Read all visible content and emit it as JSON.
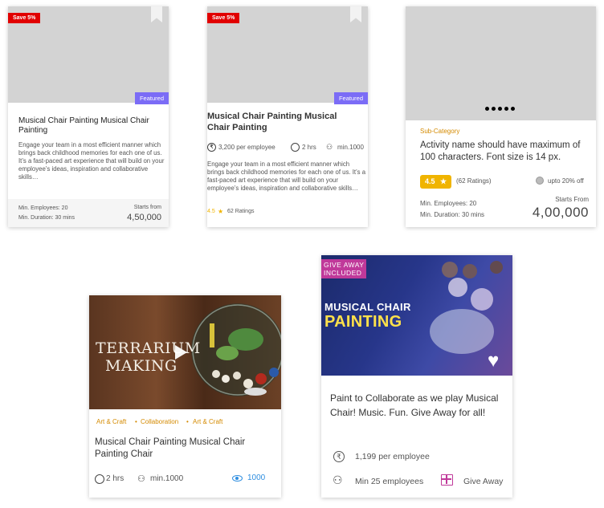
{
  "card1": {
    "save_badge": "Save 5%",
    "featured": "Featured",
    "title": "Musical Chair Painting Musical Chair Painting",
    "desc": "Engage your team in a most efficient manner which brings back childhood memories for each one of us. It’s a fast-paced art experience that will build on your employee’s ideas, inspiration and collaborative skills…",
    "min_employees": "Min. Employees: 20",
    "min_duration": "Min. Duration: 30 mins",
    "starts_from": "Starts from",
    "price": "4,50,000"
  },
  "card2": {
    "save_badge": "Save 5%",
    "featured": "Featured",
    "title": "Musical Chair Painting Musical Chair Painting",
    "per_employee": "3,200 per employee",
    "duration": "2 hrs",
    "min": "min.1000",
    "desc": "Engage your team in a most efficient manner which brings back childhood memories for each one of us. It’s a fast-paced art experience that will build on your employee’s ideas, inspiration and collaborative skills…",
    "rating": "4.5",
    "ratings_count": "62 Ratings"
  },
  "card3": {
    "sub_category": "Sub-Category",
    "title": "Activity name should have maximum of 100 characters. Font size is 14 px.",
    "rating": "4.5",
    "ratings_count": "(62 Ratings)",
    "discount": "upto 20% off",
    "min_employees": "Min. Employees: 20",
    "min_duration": "Min. Duration: 30 mins",
    "starts_from": "Starts From",
    "price": "4,00,000"
  },
  "card4": {
    "image_text_line1": "TERRARIUM",
    "image_text_line2": "MAKING",
    "tags": [
      "Art & Craft",
      "Collaboration",
      "Art & Craft"
    ],
    "title": "Musical Chair Painting Musical Chair Painting Chair",
    "duration": "2 hrs",
    "min": "min.1000",
    "views": "1000"
  },
  "card5": {
    "giveaway_badge_line1": "GIVE AWAY",
    "giveaway_badge_line2": "INCLUDED",
    "image_text_line1": "MUSICAL CHAIR",
    "image_text_line2": "PAINTING",
    "description": "Paint to Collaborate as we play Musical Chair! Music. Fun. Give Away for all!",
    "per_employee": "1,199 per employee",
    "min_employees": "Min 25 employees",
    "give_away": "Give Away"
  },
  "colors": {
    "save_red": "#e10000",
    "featured_purple": "#7b6cf6",
    "rating_yellow": "#f0b400",
    "subcategory_orange": "#d48a00",
    "views_blue": "#2f8ee0",
    "gift_magenta": "#c0399a"
  }
}
